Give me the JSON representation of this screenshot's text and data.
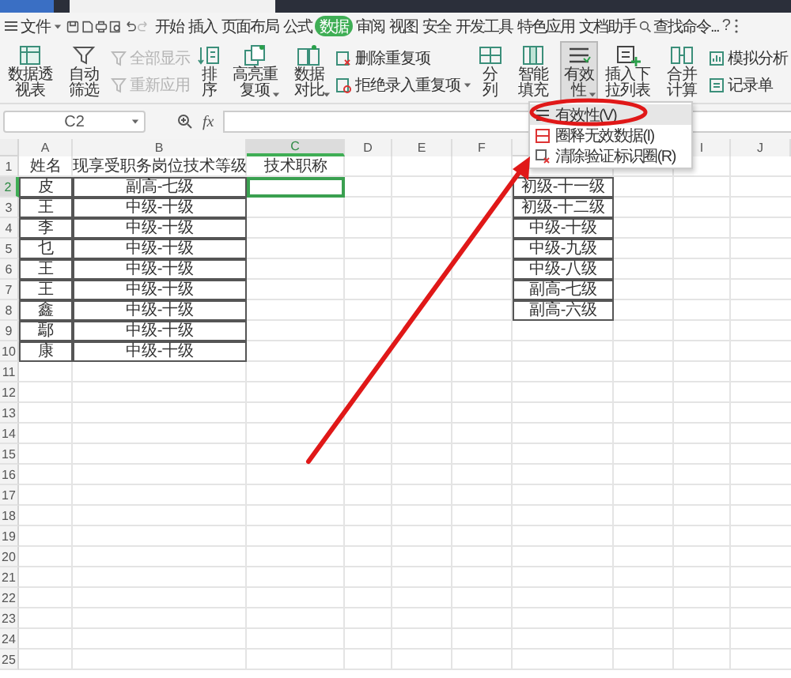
{
  "menu_bar": {
    "file_menu": "文件",
    "tabs": [
      {
        "label": "开始",
        "selected": false
      },
      {
        "label": "插入",
        "selected": false
      },
      {
        "label": "页面布局",
        "selected": false
      },
      {
        "label": "公式",
        "selected": false
      },
      {
        "label": "数据",
        "selected": true
      },
      {
        "label": "审阅",
        "selected": false
      },
      {
        "label": "视图",
        "selected": false
      },
      {
        "label": "安全",
        "selected": false
      },
      {
        "label": "开发工具",
        "selected": false
      },
      {
        "label": "特色应用",
        "selected": false
      },
      {
        "label": "文档助手",
        "selected": false
      }
    ],
    "search": "查找命令...",
    "help": "?"
  },
  "ribbon": [
    {
      "kind": "large",
      "label": "数据透视表",
      "dropdown": false,
      "pressed": false
    },
    {
      "kind": "large",
      "label": "自动筛选",
      "dropdown": false,
      "pressed": false
    },
    {
      "kind": "stack",
      "items": [
        {
          "label": "全部显示",
          "disabled": true,
          "dropdown": false
        },
        {
          "label": "重新应用",
          "disabled": true,
          "dropdown": false
        }
      ]
    },
    {
      "kind": "large",
      "label": "排序",
      "dropdown": false,
      "pressed": false
    },
    {
      "kind": "large",
      "label": "高亮重复项",
      "dropdown": true,
      "pressed": false
    },
    {
      "kind": "large",
      "label": "数据对比",
      "dropdown": true,
      "pressed": false
    },
    {
      "kind": "stack",
      "items": [
        {
          "label": "删除重复项",
          "disabled": false,
          "dropdown": false
        },
        {
          "label": "拒绝录入重复项",
          "disabled": false,
          "dropdown": true
        }
      ]
    },
    {
      "kind": "large",
      "label": "分列",
      "dropdown": false,
      "pressed": false
    },
    {
      "kind": "large",
      "label": "智能填充",
      "dropdown": false,
      "pressed": false
    },
    {
      "kind": "large",
      "label": "有效性",
      "dropdown": true,
      "pressed": true
    },
    {
      "kind": "large",
      "label": "插入下拉列表",
      "dropdown": false,
      "pressed": false
    },
    {
      "kind": "large",
      "label": "合并计算",
      "dropdown": false,
      "pressed": false
    },
    {
      "kind": "stack",
      "items": [
        {
          "label": "模拟分析",
          "disabled": false,
          "dropdown": false
        },
        {
          "label": "记录单",
          "disabled": false,
          "dropdown": false
        }
      ]
    }
  ],
  "dropdown_menu": [
    {
      "label": "有效性(V)",
      "selected": true
    },
    {
      "label": "圈释无效数据(I)",
      "selected": false
    },
    {
      "label": "清除验证标识圈(R)",
      "selected": false
    }
  ],
  "formula_bar": {
    "name_box": "C2",
    "fx": "fx"
  },
  "sheet": {
    "columns": [
      {
        "label": "A",
        "selected": false
      },
      {
        "label": "B",
        "selected": false
      },
      {
        "label": "C",
        "selected": true
      },
      {
        "label": "D",
        "selected": false
      },
      {
        "label": "E",
        "selected": false
      },
      {
        "label": "F",
        "selected": false
      },
      {},
      {},
      {
        "label": "I",
        "selected": false
      },
      {
        "label": "J",
        "selected": false
      }
    ],
    "rows": [
      {
        "label": "1",
        "selected": false,
        "A": {
          "text": "姓名",
          "bordered": false
        },
        "B": {
          "text": "现享受职务岗位技术等级",
          "bordered": false
        },
        "C": {
          "text": "技术职称",
          "bordered": false
        }
      },
      {
        "label": "2",
        "selected": true,
        "A": {
          "text": "皮",
          "bordered": true
        },
        "B": {
          "text": "副高-七级",
          "bordered": true
        },
        "G": {
          "text": "初级-十一级",
          "bordered": true
        }
      },
      {
        "label": "3",
        "selected": false,
        "A": {
          "text": "王",
          "bordered": true
        },
        "B": {
          "text": "中级-十级",
          "bordered": true
        },
        "G": {
          "text": "初级-十二级",
          "bordered": true
        }
      },
      {
        "label": "4",
        "selected": false,
        "A": {
          "text": "李",
          "bordered": true
        },
        "B": {
          "text": "中级-十级",
          "bordered": true
        },
        "G": {
          "text": "中级-十级",
          "bordered": true
        }
      },
      {
        "label": "5",
        "selected": false,
        "A": {
          "text": "乜",
          "bordered": true
        },
        "B": {
          "text": "中级-十级",
          "bordered": true
        },
        "G": {
          "text": "中级-九级",
          "bordered": true
        }
      },
      {
        "label": "6",
        "selected": false,
        "A": {
          "text": "王",
          "bordered": true
        },
        "B": {
          "text": "中级-十级",
          "bordered": true
        },
        "G": {
          "text": "中级-八级",
          "bordered": true
        }
      },
      {
        "label": "7",
        "selected": false,
        "A": {
          "text": "王",
          "bordered": true
        },
        "B": {
          "text": "中级-十级",
          "bordered": true
        },
        "G": {
          "text": "副高-七级",
          "bordered": true
        }
      },
      {
        "label": "8",
        "selected": false,
        "A": {
          "text": "鑫",
          "bordered": true
        },
        "B": {
          "text": "中级-十级",
          "bordered": true
        },
        "G": {
          "text": "副高-六级",
          "bordered": true
        }
      },
      {
        "label": "9",
        "selected": false,
        "A": {
          "text": "鄢",
          "bordered": true
        },
        "B": {
          "text": "中级-十级",
          "bordered": true
        }
      },
      {
        "label": "10",
        "selected": false,
        "A": {
          "text": "康",
          "bordered": true
        },
        "B": {
          "text": "中级-十级",
          "bordered": true
        }
      },
      {
        "label": "11",
        "selected": false
      },
      {
        "label": "12",
        "selected": false
      },
      {
        "label": "13",
        "selected": false
      },
      {
        "label": "14",
        "selected": false
      },
      {
        "label": "15",
        "selected": false
      },
      {
        "label": "16",
        "selected": false
      },
      {
        "label": "17",
        "selected": false
      },
      {
        "label": "18",
        "selected": false
      },
      {
        "label": "19",
        "selected": false
      },
      {
        "label": "20",
        "selected": false
      },
      {
        "label": "21",
        "selected": false
      },
      {
        "label": "22",
        "selected": false
      },
      {
        "label": "23",
        "selected": false
      },
      {
        "label": "24",
        "selected": false
      },
      {
        "label": "25",
        "selected": false
      }
    ]
  },
  "annotations": {
    "ellipse": true,
    "arrow": true
  }
}
